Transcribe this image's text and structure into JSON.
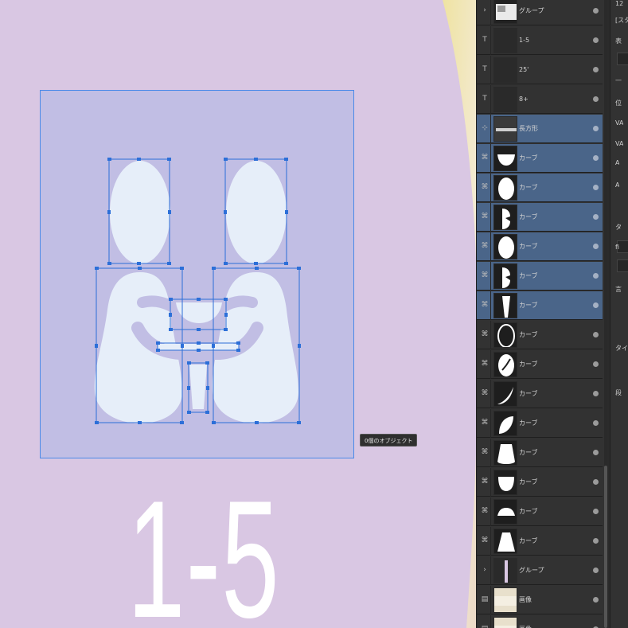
{
  "canvas": {
    "background": "#d9c7e3",
    "artboard_fill": "#c1bee4",
    "selection_color": "#4b8ae8",
    "shape_fill": "#e6eef9",
    "tooltip": "0個のオブジェクト",
    "big_label": "1-5"
  },
  "layers": {
    "rows": [
      {
        "label": "グループ",
        "selected": false,
        "expander": "›",
        "thumb": "group-icon"
      },
      {
        "label": "1-5",
        "selected": false,
        "expander": "T",
        "thumb": "text-icon"
      },
      {
        "label": "25'",
        "selected": false,
        "expander": "T",
        "thumb": "text-icon"
      },
      {
        "label": "8+",
        "selected": false,
        "expander": "T",
        "thumb": "text-icon"
      },
      {
        "label": "長方形",
        "selected": true,
        "expander": "⊹",
        "thumb": "rectangle-icon"
      },
      {
        "label": "カーブ",
        "selected": true,
        "expander": "⌘",
        "thumb": "curve-bowl-icon"
      },
      {
        "label": "カーブ",
        "selected": true,
        "expander": "⌘",
        "thumb": "curve-oval-icon"
      },
      {
        "label": "カーブ",
        "selected": true,
        "expander": "⌘",
        "thumb": "curve-figure-icon"
      },
      {
        "label": "カーブ",
        "selected": true,
        "expander": "⌘",
        "thumb": "curve-oval-icon"
      },
      {
        "label": "カーブ",
        "selected": true,
        "expander": "⌘",
        "thumb": "curve-figure-icon"
      },
      {
        "label": "カーブ",
        "selected": true,
        "expander": "⌘",
        "thumb": "curve-glass-icon"
      },
      {
        "label": "カーブ",
        "selected": false,
        "expander": "⌘",
        "thumb": "curve-ring-icon"
      },
      {
        "label": "カーブ",
        "selected": false,
        "expander": "⌘",
        "thumb": "curve-clock-icon"
      },
      {
        "label": "カーブ",
        "selected": false,
        "expander": "⌘",
        "thumb": "curve-crescent-icon"
      },
      {
        "label": "カーブ",
        "selected": false,
        "expander": "⌘",
        "thumb": "curve-leaf-icon"
      },
      {
        "label": "カーブ",
        "selected": false,
        "expander": "⌘",
        "thumb": "curve-cup-icon"
      },
      {
        "label": "カーブ",
        "selected": false,
        "expander": "⌘",
        "thumb": "curve-bowl2-icon"
      },
      {
        "label": "カーブ",
        "selected": false,
        "expander": "⌘",
        "thumb": "curve-dome-icon"
      },
      {
        "label": "カーブ",
        "selected": false,
        "expander": "⌘",
        "thumb": "curve-vase-icon"
      },
      {
        "label": "グループ",
        "selected": false,
        "expander": "›",
        "thumb": "group-bar-icon"
      },
      {
        "label": "画像",
        "selected": false,
        "expander": "▤",
        "thumb": "image-icon"
      },
      {
        "label": "画像",
        "selected": false,
        "expander": "▤",
        "thumb": "image-icon"
      }
    ]
  },
  "props": {
    "items": [
      "12",
      "[スタ",
      "表",
      "位",
      "VA",
      "VA",
      "A",
      "A",
      "タ",
      "fi",
      "言",
      "タイ",
      "段"
    ]
  }
}
